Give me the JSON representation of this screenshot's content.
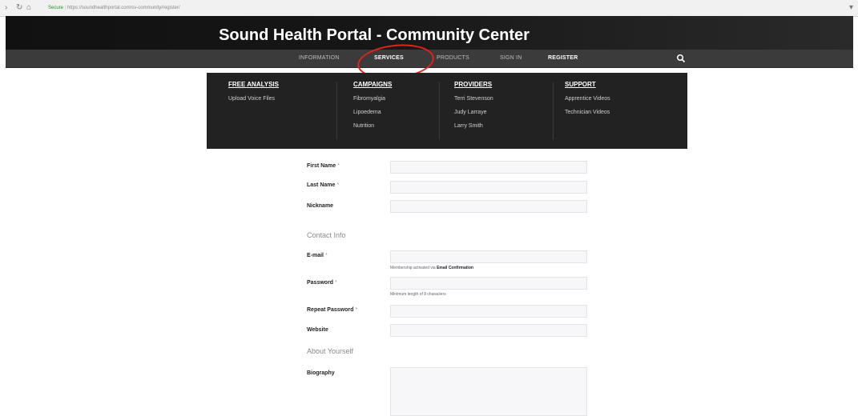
{
  "browser": {
    "secure_label": "Secure",
    "url": "https://soundhealthportal.com/sv-community/register/"
  },
  "site": {
    "title": "Sound Health Portal - Community Center"
  },
  "nav": {
    "items": [
      {
        "label": "Information",
        "bold": false
      },
      {
        "label": "Services",
        "bold": true
      },
      {
        "label": "Products",
        "bold": false
      },
      {
        "label": "Sign In",
        "bold": false
      },
      {
        "label": "Register",
        "bold": true
      }
    ],
    "search_icon": "search-icon"
  },
  "annotation": {
    "color": "#e2231a",
    "target": "Services"
  },
  "menu": {
    "columns": [
      {
        "heading": "Free Analysis",
        "links": [
          "Upload Voice Files"
        ]
      },
      {
        "heading": "Campaigns",
        "links": [
          "Fibromyalgia",
          "Lipoedema",
          "Nutrition"
        ]
      },
      {
        "heading": "Providers",
        "links": [
          "Terri Stevenson",
          "Judy Larraye",
          "Larry Smith"
        ]
      },
      {
        "heading": "Support",
        "links": [
          "Apprentice Videos",
          "Technician Videos"
        ]
      }
    ]
  },
  "form": {
    "fields_top": [
      {
        "label": "First Name",
        "required": true
      },
      {
        "label": "Last Name",
        "required": true
      },
      {
        "label": "Nickname",
        "required": false
      }
    ],
    "contact_section": "Contact Info",
    "email": {
      "label": "E-mail",
      "required": true,
      "hint_prefix": "Membership activated via",
      "hint_bold": "Email Confirmation"
    },
    "password": {
      "label": "Password",
      "required": true,
      "hint": "Minimum length of 8 characters"
    },
    "repeat_password": {
      "label": "Repeat Password",
      "required": true
    },
    "website": {
      "label": "Website",
      "required": false
    },
    "about_section": "About Yourself",
    "biography": {
      "label": "Biography"
    }
  }
}
